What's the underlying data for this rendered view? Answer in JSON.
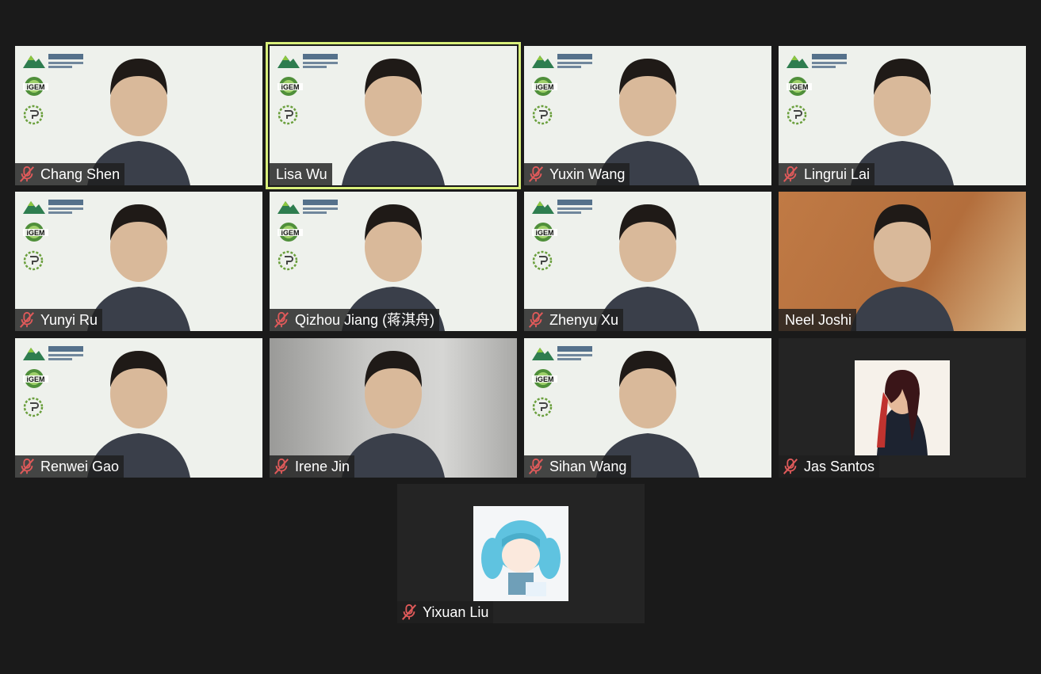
{
  "brand": {
    "dku_cn": "昆山杜克大学",
    "dku_en": "DUKE KUNSHAN UNIVERSITY",
    "igem": "iGEM"
  },
  "colors": {
    "background": "#1a1a1a",
    "active_speaker_border": "#d8ef7a",
    "muted_icon": "#e05a5a",
    "green_screen": "#eef1ec"
  },
  "participants": [
    {
      "name": "Chang Shen",
      "muted": true,
      "active": false,
      "icon": "mic-muted-icon"
    },
    {
      "name": "Lisa Wu",
      "muted": false,
      "active": true
    },
    {
      "name": "Yuxin Wang",
      "muted": true,
      "active": false,
      "icon": "mic-muted-icon"
    },
    {
      "name": "Lingrui Lai",
      "muted": true,
      "active": false,
      "icon": "mic-muted-icon"
    },
    {
      "name": "Yunyi Ru",
      "muted": true,
      "active": false,
      "icon": "mic-muted-icon"
    },
    {
      "name": "Qizhou Jiang (蒋淇舟)",
      "muted": true,
      "active": false,
      "icon": "mic-muted-icon"
    },
    {
      "name": "Zhenyu Xu",
      "muted": true,
      "active": false,
      "icon": "mic-muted-icon"
    },
    {
      "name": "Neel Joshi",
      "muted": false,
      "active": false
    },
    {
      "name": "Renwei Gao",
      "muted": true,
      "active": false,
      "icon": "mic-muted-icon"
    },
    {
      "name": "Irene Jin",
      "muted": true,
      "active": false,
      "icon": "mic-muted-icon"
    },
    {
      "name": "Sihan Wang",
      "muted": true,
      "active": false,
      "icon": "mic-muted-icon"
    },
    {
      "name": "Jas Santos",
      "muted": true,
      "active": false,
      "icon": "mic-muted-icon"
    },
    {
      "name": "Yixuan Liu",
      "muted": true,
      "active": false,
      "icon": "mic-muted-icon"
    }
  ]
}
